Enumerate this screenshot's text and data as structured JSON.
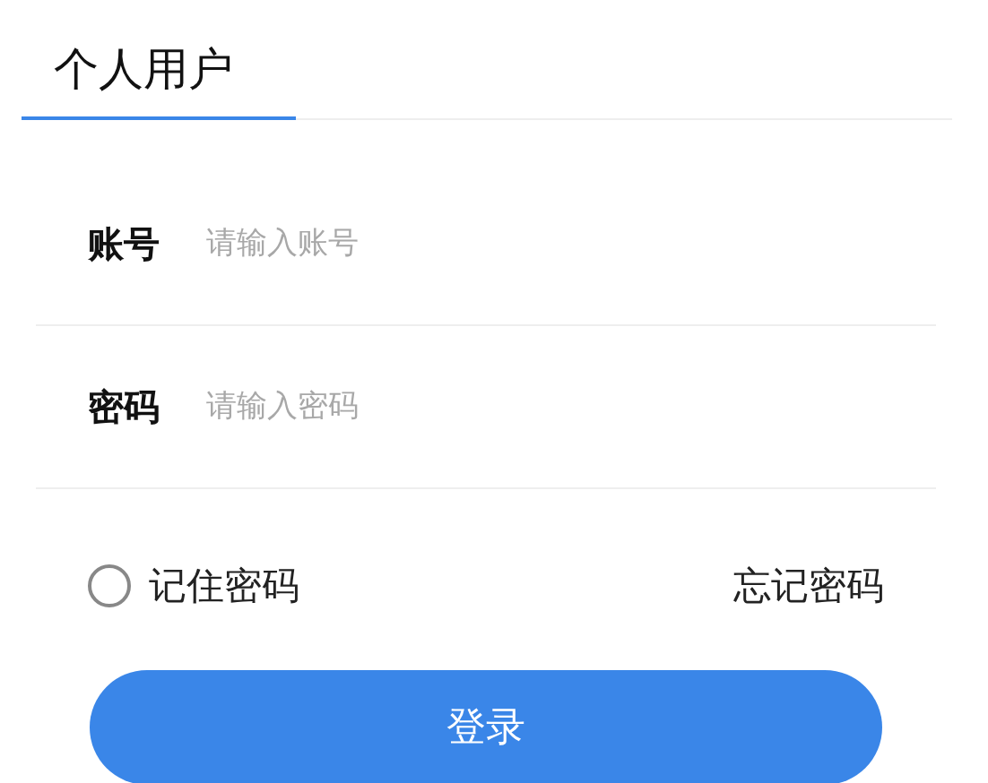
{
  "tabs": [
    {
      "label": "个人用户",
      "selected": true
    }
  ],
  "fields": [
    {
      "label": "账号",
      "placeholder": "请输入账号"
    },
    {
      "label": "密码",
      "placeholder": "请输入密码"
    }
  ],
  "remember": {
    "label": "记住密码",
    "checked": false
  },
  "forgot_link": "忘记密码",
  "login_button": "登录"
}
